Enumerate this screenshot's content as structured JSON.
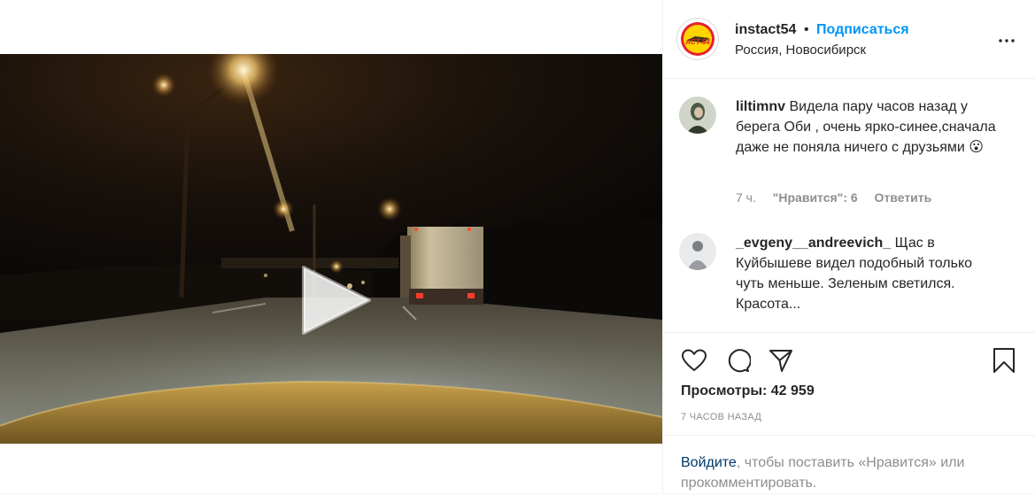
{
  "post": {
    "account": {
      "username": "instact54",
      "separator": "•",
      "follow_label": "Подписаться",
      "location": "Россия, Новосибирск",
      "avatar_text": "ACT-54"
    },
    "comments": [
      {
        "username": "liltimnv",
        "text": "Видела пару часов назад у берега Оби , очень ярко-синее,сначала даже не поняла ничего с друзьями 😮",
        "time": "7 ч.",
        "likes": "\"Нравится\": 6",
        "reply": "Ответить"
      },
      {
        "username": "_evgeny__andreevich_",
        "text": "Щас в Куйбышеве видел подобный только чуть меньше. Зеленым светился. Красота..."
      }
    ],
    "views_label": "Просмотры: 42 959",
    "time_ago": "7 ЧАСОВ НАЗАД",
    "login_prompt": {
      "link": "Войдите",
      "rest": ", чтобы поставить «Нравится» или прокомментировать."
    },
    "icons": {
      "like": "heart-icon",
      "comment": "comment-icon",
      "share": "share-icon",
      "save": "bookmark-icon",
      "play": "play-icon",
      "more": "more-horizontal-icon"
    },
    "colors": {
      "follow_blue": "#0095f6",
      "link_dark_blue": "#00376b",
      "muted_text": "#8e8e8e"
    }
  }
}
